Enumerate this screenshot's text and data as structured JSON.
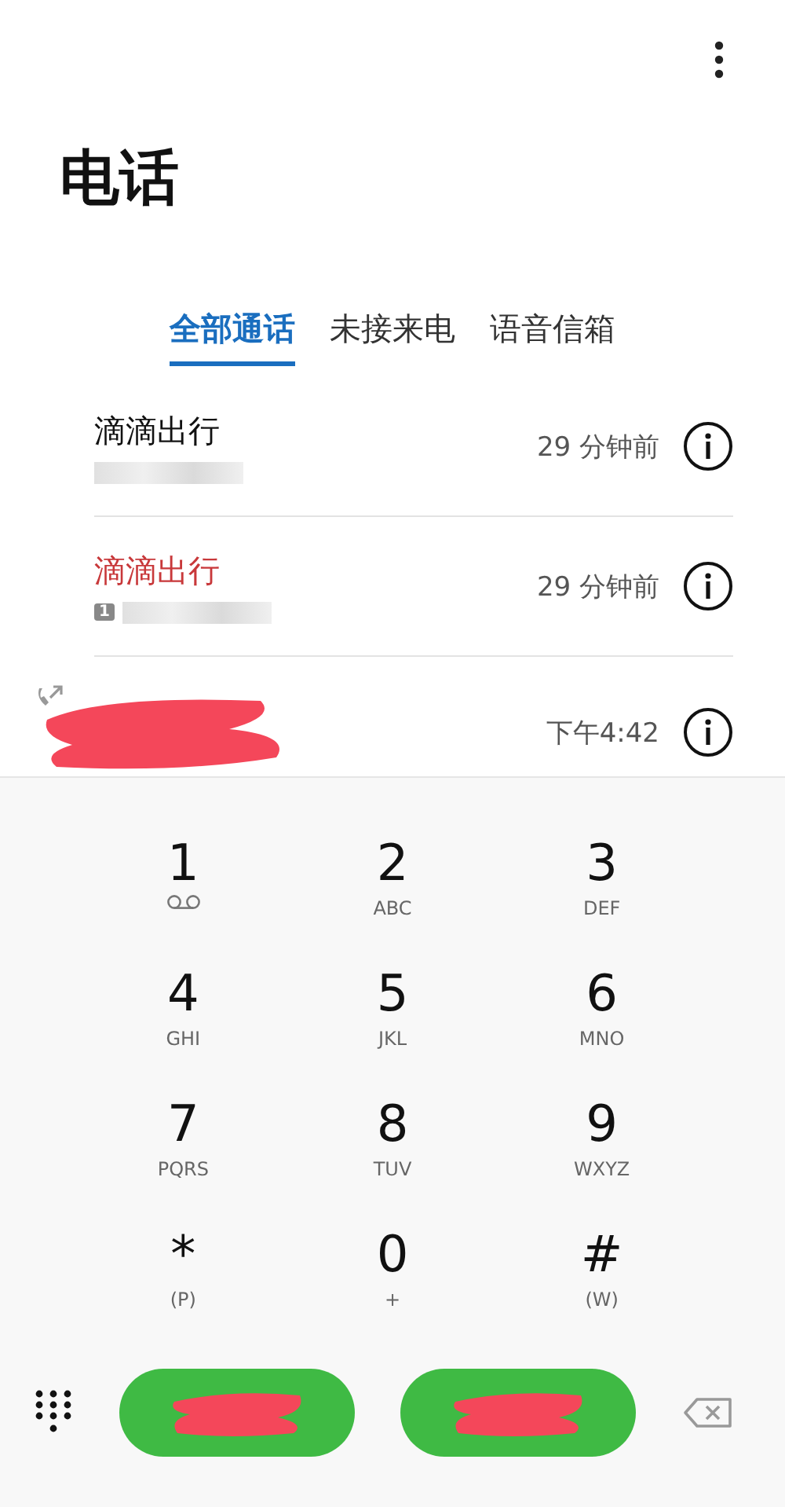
{
  "title": "电话",
  "tabs": [
    {
      "label": "全部通话",
      "selected": true
    },
    {
      "label": "未接来电",
      "selected": false
    },
    {
      "label": "语音信箱",
      "selected": false
    }
  ],
  "calls": [
    {
      "kind": "contact",
      "name": "滴滴出行",
      "missed": false,
      "time": "29 分钟前"
    },
    {
      "kind": "contact",
      "name": "滴滴出行",
      "missed": true,
      "sim": "1",
      "time": "29 分钟前"
    },
    {
      "kind": "redacted",
      "time": "下午4:42"
    }
  ],
  "keys": [
    {
      "digit": "1",
      "kind": "voicemail"
    },
    {
      "digit": "2",
      "letters": "ABC"
    },
    {
      "digit": "3",
      "letters": "DEF"
    },
    {
      "digit": "4",
      "letters": "GHI"
    },
    {
      "digit": "5",
      "letters": "JKL"
    },
    {
      "digit": "6",
      "letters": "MNO"
    },
    {
      "digit": "7",
      "letters": "PQRS"
    },
    {
      "digit": "8",
      "letters": "TUV"
    },
    {
      "digit": "9",
      "letters": "WXYZ"
    },
    {
      "digit": "*",
      "letters": "(P)"
    },
    {
      "digit": "0",
      "letters": "+"
    },
    {
      "digit": "#",
      "letters": "(W)"
    }
  ],
  "call_buttons": [
    {
      "kind": "redacted"
    },
    {
      "kind": "redacted"
    }
  ]
}
